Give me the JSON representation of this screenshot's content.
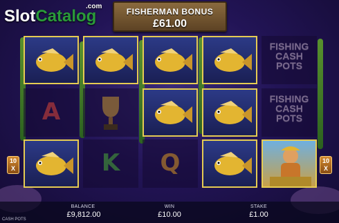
{
  "logo": {
    "slot": "Slot",
    "catalog": "Catalog",
    "com": ".com"
  },
  "bonus": {
    "title": "FISHERMAN BONUS",
    "amount": "£61.00"
  },
  "pots_symbol": {
    "line1": "FISHING",
    "line2": "CASH",
    "line3": "POTS"
  },
  "letters": {
    "a": "A",
    "k": "K",
    "q": "Q"
  },
  "multiplier_left": {
    "top": "10",
    "bottom": "X"
  },
  "multiplier_right": {
    "top": "10",
    "bottom": "X"
  },
  "footer": {
    "balance_label": "BALANCE",
    "balance_value": "£9,812.00",
    "win_label": "WIN",
    "win_value": "£10.00",
    "stake_label": "STAKE",
    "stake_value": "£1.00",
    "cash_pots_label": "CASH POTS"
  },
  "colors": {
    "frame": "#e6cc52",
    "logo_green": "#2a9a3a",
    "background": "#221456"
  }
}
